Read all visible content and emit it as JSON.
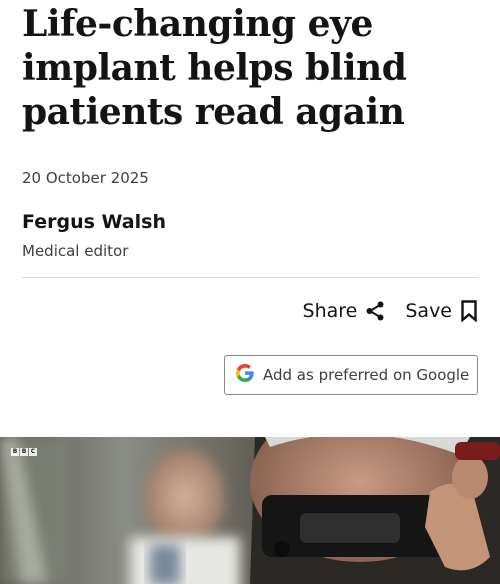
{
  "article": {
    "headline": "Life-changing eye implant helps blind patients read again",
    "date": "20 October 2025",
    "author": {
      "name": "Fergus Walsh",
      "role": "Medical editor"
    }
  },
  "actions": {
    "share_label": "Share",
    "save_label": "Save",
    "share_icon": "share-icon",
    "save_icon": "bookmark-icon"
  },
  "google_button": {
    "label": "Add as preferred on Google",
    "icon": "google-g-icon"
  },
  "media": {
    "logo_letters": [
      "B",
      "B",
      "C"
    ]
  },
  "colors": {
    "text": "#141414",
    "secondary_text": "#3f3f42",
    "divider": "#d9d9d9",
    "button_border": "#8a8a8a",
    "google_blue": "#4285F4",
    "google_red": "#EA4335",
    "google_yellow": "#FBBC05",
    "google_green": "#34A853"
  }
}
